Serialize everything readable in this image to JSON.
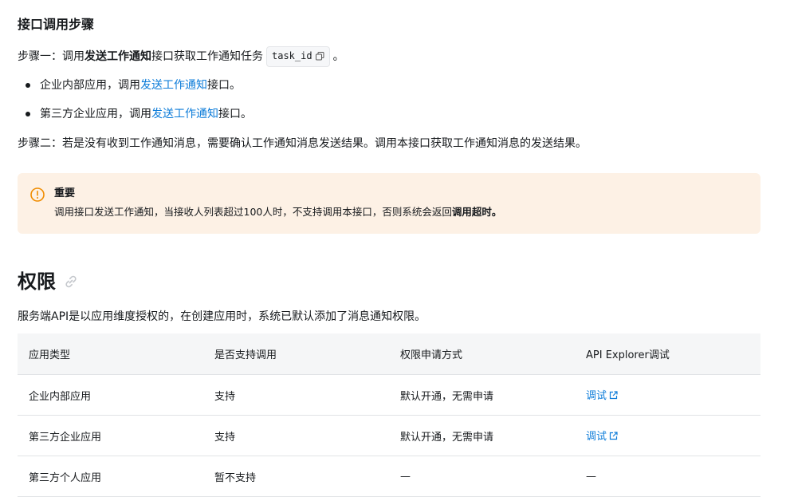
{
  "steps": {
    "heading": "接口调用步骤",
    "step1": {
      "prefix": "步骤一：调用",
      "api_name": "发送工作通知",
      "middle": "接口获取工作通知任务",
      "code": "task_id",
      "suffix": "。"
    },
    "bullets": [
      {
        "prefix": "企业内部应用，调用",
        "link": "发送工作通知",
        "suffix": "接口。"
      },
      {
        "prefix": "第三方企业应用，调用",
        "link": "发送工作通知",
        "suffix": "接口。"
      }
    ],
    "step2": "步骤二：若是没有收到工作通知消息，需要确认工作通知消息发送结果。调用本接口获取工作通知消息的发送结果。"
  },
  "callout": {
    "title": "重要",
    "body_prefix": "调用接口发送工作通知，当接收人列表超过100人时，不支持调用本接口，否则系统会返回",
    "body_bold": "调用超时。",
    "icon": "warning-circle-icon",
    "accent_color": "#f08c00",
    "background_color": "#fdf1e5"
  },
  "permissions": {
    "heading": "权限",
    "description": "服务端API是以应用维度授权的，在创建应用时，系统已默认添加了消息通知权限。",
    "table": {
      "headers": [
        "应用类型",
        "是否支持调用",
        "权限申请方式",
        "API Explorer调试"
      ],
      "rows": [
        [
          "企业内部应用",
          "支持",
          "默认开通，无需申请",
          "调试"
        ],
        [
          "第三方企业应用",
          "支持",
          "默认开通，无需申请",
          "调试"
        ],
        [
          "第三方个人应用",
          "暂不支持",
          "—",
          "—"
        ]
      ]
    }
  },
  "colors": {
    "link": "#0d7cd9",
    "text": "#171a1d"
  }
}
